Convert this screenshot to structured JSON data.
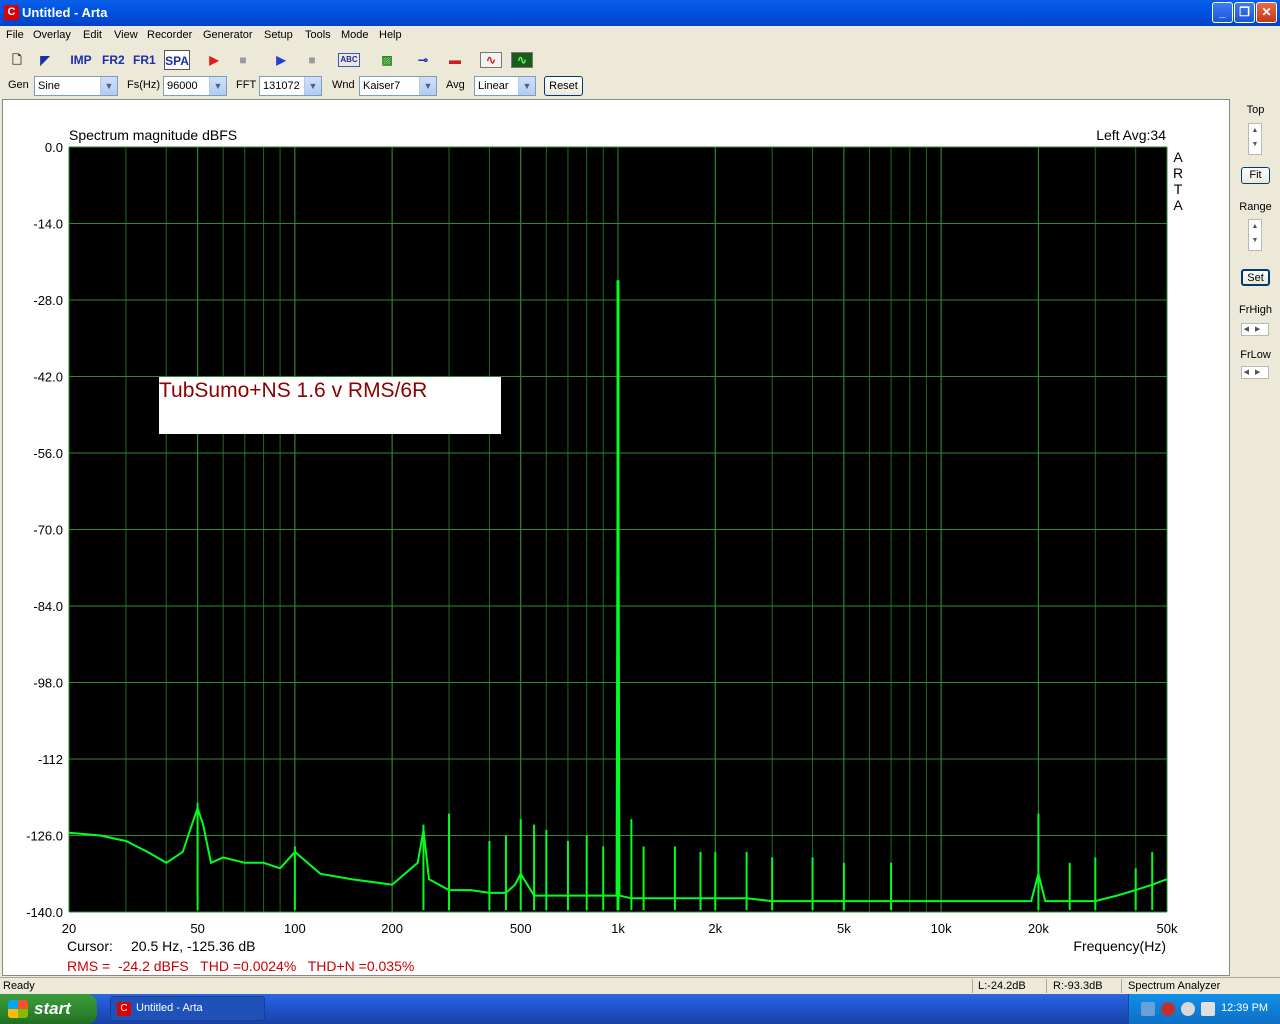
{
  "window": {
    "title": "Untitled - Arta",
    "icon": "arta-logo-icon"
  },
  "menu": [
    "File",
    "Overlay",
    "Edit",
    "View",
    "Recorder",
    "Generator",
    "Setup",
    "Tools",
    "Mode",
    "Help"
  ],
  "toolbar": {
    "imp": "IMP",
    "fr2": "FR2",
    "fr1": "FR1",
    "spa": "SPA",
    "abc": "ABC"
  },
  "params": {
    "gen_label": "Gen",
    "gen_value": "Sine",
    "fs_label": "Fs(Hz)",
    "fs_value": "96000",
    "fft_label": "FFT",
    "fft_value": "131072",
    "wnd_label": "Wnd",
    "wnd_value": "Kaiser7",
    "avg_label": "Avg",
    "avg_value": "Linear",
    "reset": "Reset"
  },
  "plot": {
    "title": "Spectrum magnitude dBFS",
    "channel_avg": "Left  Avg:34",
    "arta_label": [
      "A",
      "R",
      "T",
      "A"
    ],
    "annotation": "TubSumo+NS 1.6 v RMS/6R",
    "cursor_label": "Cursor:",
    "cursor_value": "20.5 Hz, -125.36 dB",
    "measurements": "RMS =  -24.2 dBFS   THD =0.0024%   THD+N =0.035%",
    "colors": {
      "plot_bg": "#000000",
      "grid": "#1f6a1f",
      "trace": "#00ff20",
      "annotation_text": "#8b0000",
      "measure_text": "#cc0000"
    }
  },
  "chart_data": {
    "type": "line",
    "title": "Spectrum magnitude dBFS",
    "xlabel": "Frequency(Hz)",
    "ylabel": "",
    "x_scale": "log",
    "xlim": [
      20,
      50000
    ],
    "ylim": [
      -140,
      0
    ],
    "x_ticks": [
      20,
      50,
      100,
      200,
      500,
      1000,
      2000,
      5000,
      10000,
      20000,
      50000
    ],
    "x_tick_labels": [
      "20",
      "50",
      "100",
      "200",
      "500",
      "1k",
      "2k",
      "5k",
      "10k",
      "20k",
      "50k"
    ],
    "y_ticks": [
      0,
      -14,
      -28,
      -42,
      -56,
      -70,
      -84,
      -98,
      -112,
      -126,
      -140
    ],
    "y_tick_labels": [
      "0.0",
      "-14.0",
      "-28.0",
      "-42.0",
      "-56.0",
      "-70.0",
      "-84.0",
      "-98.0",
      "-112",
      "-126.0",
      "-140.0"
    ],
    "grid": true,
    "series": [
      {
        "x": [
          20,
          25,
          30,
          35,
          40,
          45,
          48,
          50,
          52,
          55,
          60,
          70,
          80,
          90,
          100,
          120,
          150,
          200,
          240,
          250,
          260,
          300,
          350,
          400,
          450,
          480,
          500,
          550,
          600,
          700,
          800,
          900,
          990,
          1000,
          1010,
          1100,
          1500,
          2000,
          2500,
          3000,
          4000,
          5000,
          7000,
          10000,
          15000,
          19000,
          20000,
          21000,
          25000,
          30000,
          35000,
          40000,
          45000,
          50000
        ],
        "y": [
          -125.5,
          -126,
          -127,
          -129,
          -131,
          -129,
          -124,
          -121,
          -124,
          -131,
          -130,
          -131,
          -131,
          -132,
          -129,
          -133,
          -134,
          -135,
          -131,
          -125,
          -134,
          -136,
          -136,
          -136.5,
          -136.5,
          -135,
          -133,
          -137,
          -137,
          -137,
          -137,
          -137,
          -137,
          -24.4,
          -137,
          -137.5,
          -137.5,
          -137.5,
          -137.5,
          -138,
          -138,
          -138,
          -138,
          -138,
          -138,
          -138,
          -133,
          -138,
          -138,
          -138,
          -137,
          -136,
          -135,
          -134
        ]
      }
    ],
    "peaks_hz": [
      50,
      100,
      250,
      300,
      400,
      450,
      500,
      550,
      600,
      700,
      800,
      900,
      1000,
      1100,
      1200,
      1500,
      1800,
      2000,
      2500,
      3000,
      4000,
      5000,
      7000,
      20000,
      25000,
      30000,
      40000,
      45000
    ],
    "peaks_db": [
      -120,
      -128,
      -124,
      -122,
      -127,
      -126,
      -123,
      -124,
      -125,
      -127,
      -126,
      -128,
      -24.4,
      -123,
      -128,
      -128,
      -129,
      -129,
      -129,
      -130,
      -130,
      -131,
      -131,
      -122,
      -131,
      -130,
      -132,
      -129
    ]
  },
  "right_panel": {
    "top": "Top",
    "fit": "Fit",
    "range": "Range",
    "set": "Set",
    "frhigh": "FrHigh",
    "frlow": "FrLow"
  },
  "status": {
    "ready": "Ready",
    "left": "L:-24.2dB",
    "right": "R:-93.3dB",
    "mode": "Spectrum Analyzer"
  },
  "taskbar": {
    "start": "start",
    "task": "Untitled - Arta",
    "clock": "12:39 PM"
  }
}
